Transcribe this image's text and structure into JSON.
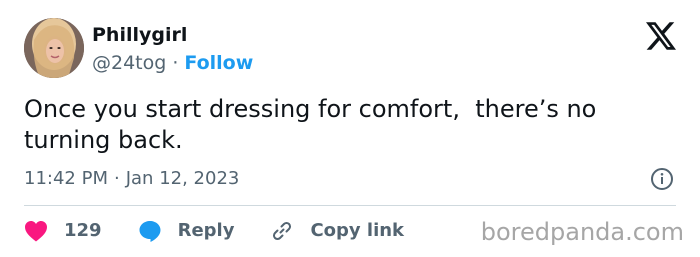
{
  "user": {
    "display_name": "Phillygirl",
    "handle": "@24tog",
    "separator": "·",
    "follow_label": "Follow"
  },
  "tweet": {
    "text": "Once you start dressing for comfort,  there’s no\nturning back.",
    "time": "11:42 PM",
    "separator": "·",
    "date": "Jan 12, 2023"
  },
  "actions": {
    "like_count": "129",
    "reply_label": "Reply",
    "copy_link_label": "Copy link"
  },
  "watermark": "boredpanda.com",
  "colors": {
    "accent": "#1d9bf0",
    "like": "#f91880",
    "text": "#0f1419",
    "muted": "#536471"
  },
  "icons": [
    "x-logo-icon",
    "info-icon",
    "heart-icon",
    "reply-bubble-icon",
    "link-icon"
  ]
}
